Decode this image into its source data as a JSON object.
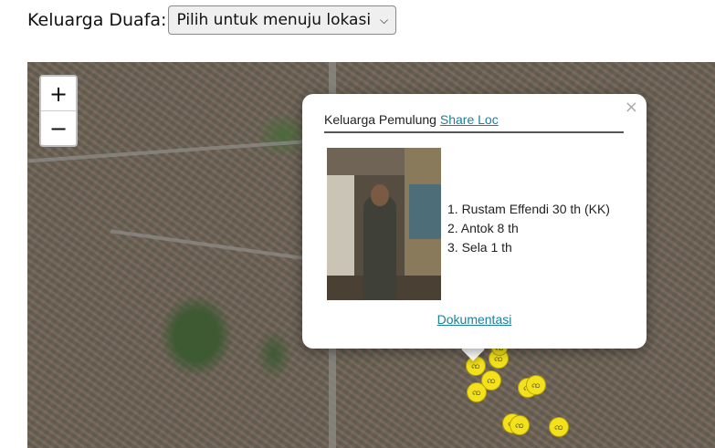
{
  "header": {
    "label": "Keluarga Duafa:",
    "select_value": "Pilih untuk menuju lokasi"
  },
  "map": {
    "zoom_in": "+",
    "zoom_out": "−",
    "marker_icon": "coin-marker-icon",
    "marker_color": "#f2e11b"
  },
  "popup": {
    "close": "×",
    "title": "Keluarga Pemulung",
    "share_link": "Share Loc",
    "members": [
      "1. Rustam Effendi 30 th (KK)",
      "2. Antok 8 th",
      "3. Sela 1 th"
    ],
    "doc_link": "Dokumentasi"
  }
}
